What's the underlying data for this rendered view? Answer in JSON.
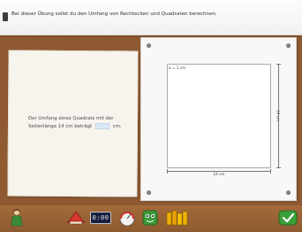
{
  "instruction": "Bei dieser Übung sollst du den Umfang von Rechtecken und Quadraten berechnen.",
  "question": {
    "text_before": "Der Umfang eines Quadrats mit der Seitenlänge 14 cm beträgt",
    "answer_value": "",
    "unit": "cm."
  },
  "figure": {
    "scale_label": "a = 1 cm",
    "bottom_dimension": "14 cm",
    "right_dimension": "14 cm"
  },
  "toolbar": {
    "clock_display": "0:00",
    "icons": [
      "figure-icon",
      "red-shape-icon",
      "clock-icon",
      "meter-icon",
      "green-monster-icon",
      "books-icon",
      "check-icon"
    ]
  },
  "colors": {
    "brick": "#b57b48",
    "paper": "#f7f4ee",
    "answer_box": "#dbe8f7",
    "check": "#3aa03a"
  }
}
